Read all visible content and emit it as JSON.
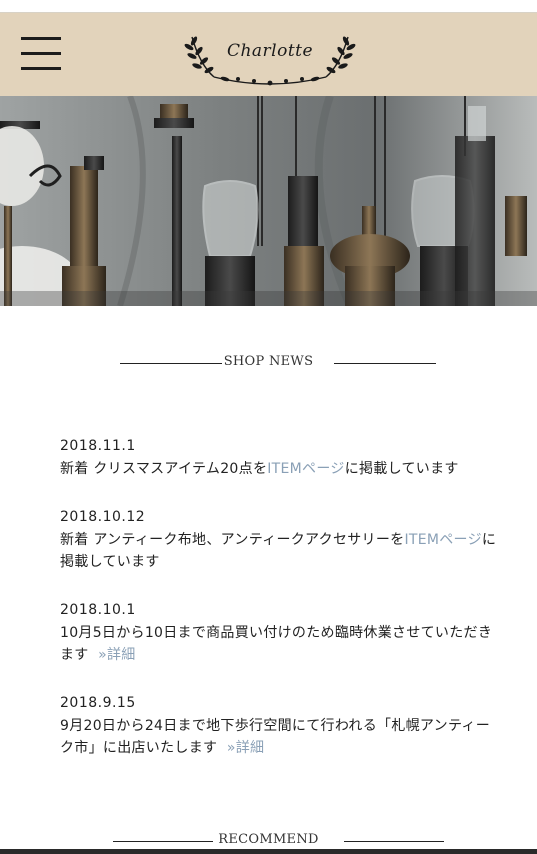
{
  "header": {
    "logo_text": "Charlotte",
    "menu_icon": "hamburger-menu-icon"
  },
  "colors": {
    "header_bg": "#e2d3bb",
    "link": "#8aa0b6",
    "text": "#222222"
  },
  "hero": {
    "image": "antique oil lamps photograph"
  },
  "shop_news": {
    "heading": "SHOP NEWS",
    "items": [
      {
        "date": "2018.11.1",
        "text_before": "新着 クリスマスアイテム20点を",
        "link": "ITEMページ",
        "text_after": "に掲載しています"
      },
      {
        "date": "2018.10.12",
        "text_before": "新着 アンティーク布地、アンティークアクセサリーを",
        "link": "ITEMページ",
        "text_after": "に掲載しています"
      },
      {
        "date": "2018.10.1",
        "text_before": "10月5日から10日まで商品買い付けのため臨時休業させていただきます",
        "link": "»詳細",
        "text_after": ""
      },
      {
        "date": "2018.9.15",
        "text_before": "9月20日から24日まで地下歩行空間にて行われる「札幌アンティーク市」に出店いたします",
        "link": "»詳細",
        "text_after": ""
      }
    ]
  },
  "recommend": {
    "heading": "RECOMMEND"
  }
}
